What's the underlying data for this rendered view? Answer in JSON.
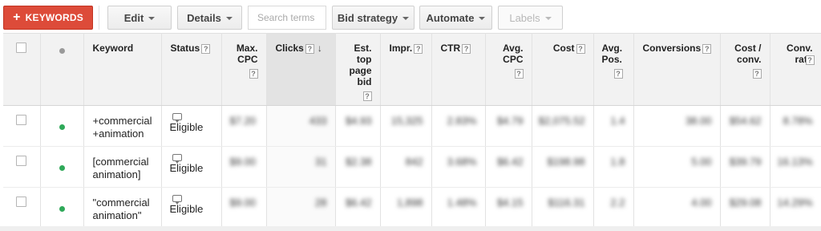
{
  "toolbar": {
    "keywords_label": "KEYWORDS",
    "edit_label": "Edit",
    "details_label": "Details",
    "search_placeholder": "Search terms",
    "bid_strategy_label": "Bid strategy",
    "automate_label": "Automate",
    "labels_label": "Labels",
    "accent_color": "#dd4b39"
  },
  "table": {
    "headers": {
      "keyword": "Keyword",
      "status": "Status",
      "max_cpc": [
        "Max.",
        "CPC"
      ],
      "clicks": "Clicks",
      "est_top_page_bid": [
        "Est.",
        "top",
        "page",
        "bid"
      ],
      "impr": "Impr.",
      "ctr": "CTR",
      "avg_cpc": [
        "Avg.",
        "CPC"
      ],
      "cost": "Cost",
      "avg_pos": [
        "Avg.",
        "Pos."
      ],
      "conversions": "Conversions",
      "cost_per_conv": [
        "Cost /",
        "conv."
      ],
      "conv_rate": [
        "Conv.",
        "rate"
      ],
      "help_glyph": "?"
    },
    "rows": [
      {
        "keyword": [
          "+commercial",
          "+animation"
        ],
        "status": "Eligible",
        "status_color": "#2fa959",
        "max_cpc": "$7.20",
        "clicks": "433",
        "est_top_page_bid": "$4.93",
        "impr": "15,325",
        "ctr": "2.83%",
        "avg_cpc": "$4.79",
        "cost": "$2,075.52",
        "avg_pos": "1.4",
        "conversions": "38.00",
        "cost_per_conv": "$54.62",
        "conv_rate": "8.78%"
      },
      {
        "keyword": [
          "[commercial",
          "animation]"
        ],
        "status": "Eligible",
        "status_color": "#2fa959",
        "max_cpc": "$9.00",
        "clicks": "31",
        "est_top_page_bid": "$2.38",
        "impr": "842",
        "ctr": "3.68%",
        "avg_cpc": "$6.42",
        "cost": "$198.98",
        "avg_pos": "1.8",
        "conversions": "5.00",
        "cost_per_conv": "$39.79",
        "conv_rate": "16.13%"
      },
      {
        "keyword": [
          "\"commercial",
          "animation\""
        ],
        "status": "Eligible",
        "status_color": "#2fa959",
        "max_cpc": "$9.00",
        "clicks": "28",
        "est_top_page_bid": "$6.42",
        "impr": "1,898",
        "ctr": "1.48%",
        "avg_cpc": "$4.15",
        "cost": "$116.31",
        "avg_pos": "2.2",
        "conversions": "4.00",
        "cost_per_conv": "$29.08",
        "conv_rate": "14.29%"
      }
    ]
  }
}
